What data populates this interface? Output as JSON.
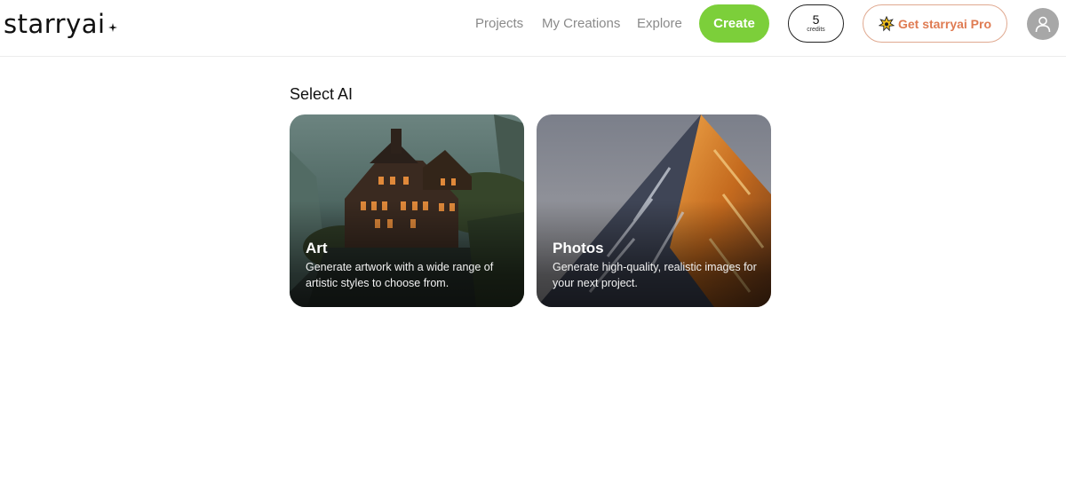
{
  "header": {
    "logo_text": "starryai",
    "nav": [
      {
        "label": "Projects"
      },
      {
        "label": "My Creations"
      },
      {
        "label": "Explore"
      }
    ],
    "create_label": "Create",
    "credits": {
      "count": "5",
      "label": "credits"
    },
    "pro_label": "Get starryai Pro",
    "colors": {
      "create": "#7ccf3a",
      "pro": "#df7b52",
      "pro_border": "#e0a990"
    }
  },
  "main": {
    "title": "Select AI",
    "cards": [
      {
        "title": "Art",
        "description": "Generate artwork with a wide range of artistic styles to choose from."
      },
      {
        "title": "Photos",
        "description": "Generate high-quality, realistic images for your next project."
      }
    ]
  },
  "icons": [
    "sparkle-star-icon",
    "pro-badge-icon",
    "user-avatar-icon"
  ]
}
